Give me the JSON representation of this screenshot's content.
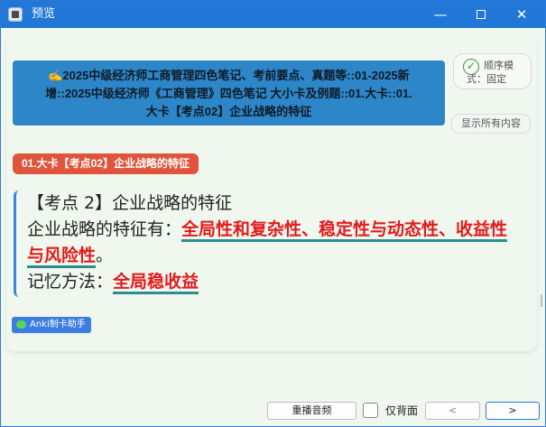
{
  "window": {
    "title": "预览",
    "minimize": "—",
    "close": "✕"
  },
  "deck_header": {
    "line1": "✍2025中级经济师工商管理四色笔记、考前要点、真题等::01-2025新",
    "line2": "增::2025中级经济师《工商管理》四色笔记 大小卡及例题::01.大卡::01.",
    "line3": "大卡【考点02】企业战略的特征"
  },
  "order_button": {
    "icon": "✓",
    "line1": "顺序模",
    "line2": "式：固定"
  },
  "show_all_button": "显示所有内容",
  "tag": "01.大卡【考点02】企业战略的特征",
  "content": {
    "heading": "【考点 2】企业战略的特征",
    "line2_prefix": "企业战略的特征有：",
    "line2_highlight": "全局性和复杂性、稳定性与动态性、收益性",
    "line3_highlight": "与风险性",
    "line3_suffix": "。",
    "line4_prefix": "记忆方法：",
    "line4_highlight": "全局稳收益"
  },
  "footer_tag": "Anki制卡助手",
  "toolbar": {
    "replay_audio": "重播音频",
    "back_only_label": "仅背面",
    "back_only_checked": false,
    "prev": "<",
    "next": ">"
  },
  "colors": {
    "titlebar": "#2177d6",
    "header_bg": "#2d86c8",
    "tag_bg": "#e0543c",
    "highlight": "#e21b1b"
  }
}
